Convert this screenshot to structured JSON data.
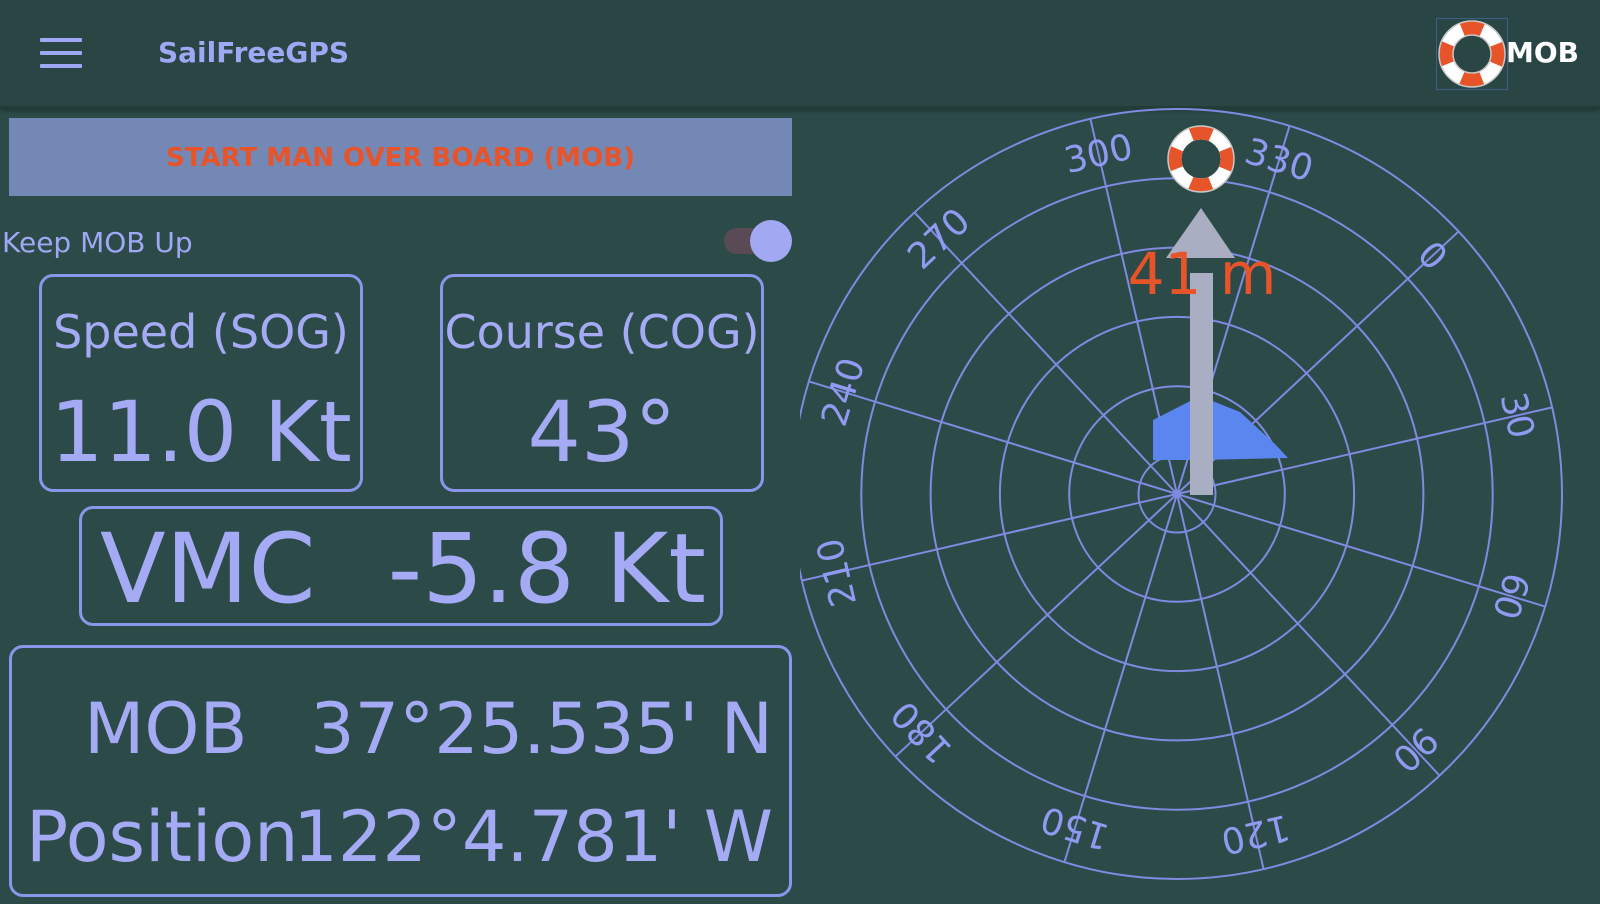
{
  "appbar": {
    "title": "SailFreeGPS",
    "menu_icon": "hamburger-menu-icon",
    "mob_action_label": "MOB",
    "mob_action_icon": "life-ring-icon"
  },
  "controls": {
    "start_mob_label": "START MAN OVER BOARD (MOB)",
    "keep_mob_up_label": "Keep MOB Up",
    "keep_mob_up_on": true
  },
  "readouts": {
    "sog_label": "Speed (SOG)",
    "sog_value": "11.0 Kt",
    "cog_label": "Course (COG)",
    "cog_value": "43°",
    "vmc_label": "VMC",
    "vmc_value": "-5.8 Kt",
    "mob_label": "MOB",
    "position_label": "Position",
    "mob_lat": "37°25.535' N",
    "mob_lon": "122°4.781' W"
  },
  "compass": {
    "bearing_labels": [
      "0",
      "30",
      "60",
      "90",
      "120",
      "150",
      "180",
      "210",
      "240",
      "270",
      "300",
      "330"
    ],
    "mob_distance": "41 m",
    "boat_heading_deg": 43
  },
  "colors": {
    "background": "#2b4a48",
    "accent": "#9ea8f4",
    "alert": "#e8542a",
    "boat": "#5b86f0"
  }
}
